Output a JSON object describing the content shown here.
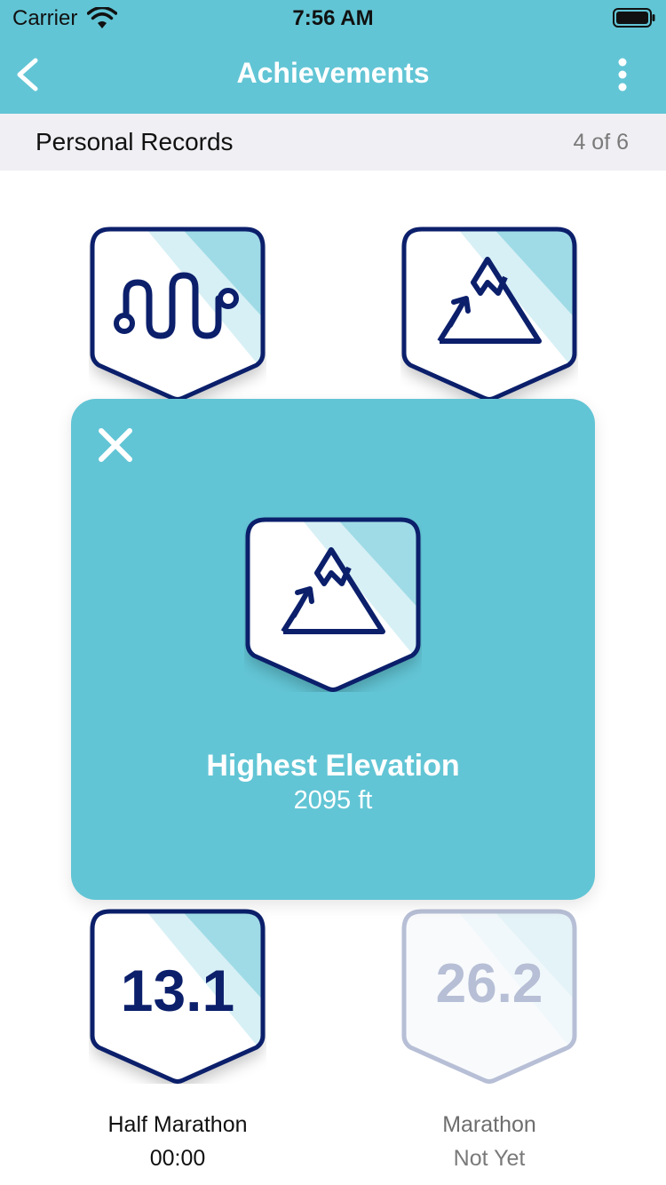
{
  "status_bar": {
    "carrier": "Carrier",
    "time": "7:56 AM",
    "wifi_icon": "wifi-icon",
    "battery_icon": "battery-icon"
  },
  "nav": {
    "title": "Achievements",
    "back_icon": "chevron-left-icon",
    "more_icon": "more-vertical-icon"
  },
  "section": {
    "title": "Personal Records",
    "count": "4 of 6"
  },
  "badges": [
    {
      "icon": "winding-route-icon",
      "label": "",
      "value": "",
      "achieved": true
    },
    {
      "icon": "mountain-icon",
      "label": "",
      "value": "",
      "achieved": true
    },
    {
      "icon": "half-marathon-badge",
      "text": "13.1",
      "label": "Half Marathon",
      "value": "00:00",
      "achieved": true
    },
    {
      "icon": "marathon-badge",
      "text": "26.2",
      "label": "Marathon",
      "value": "Not Yet",
      "achieved": false
    }
  ],
  "modal": {
    "close_icon": "close-icon",
    "badge_icon": "mountain-icon",
    "title": "Highest Elevation",
    "value": "2095 ft"
  },
  "colors": {
    "accent": "#62c5d5",
    "navy": "#0b1f6b",
    "badge_stripe": "#9fdbe6",
    "muted_badge": "#b7bfd6",
    "muted_text": "#7a7a7a"
  }
}
